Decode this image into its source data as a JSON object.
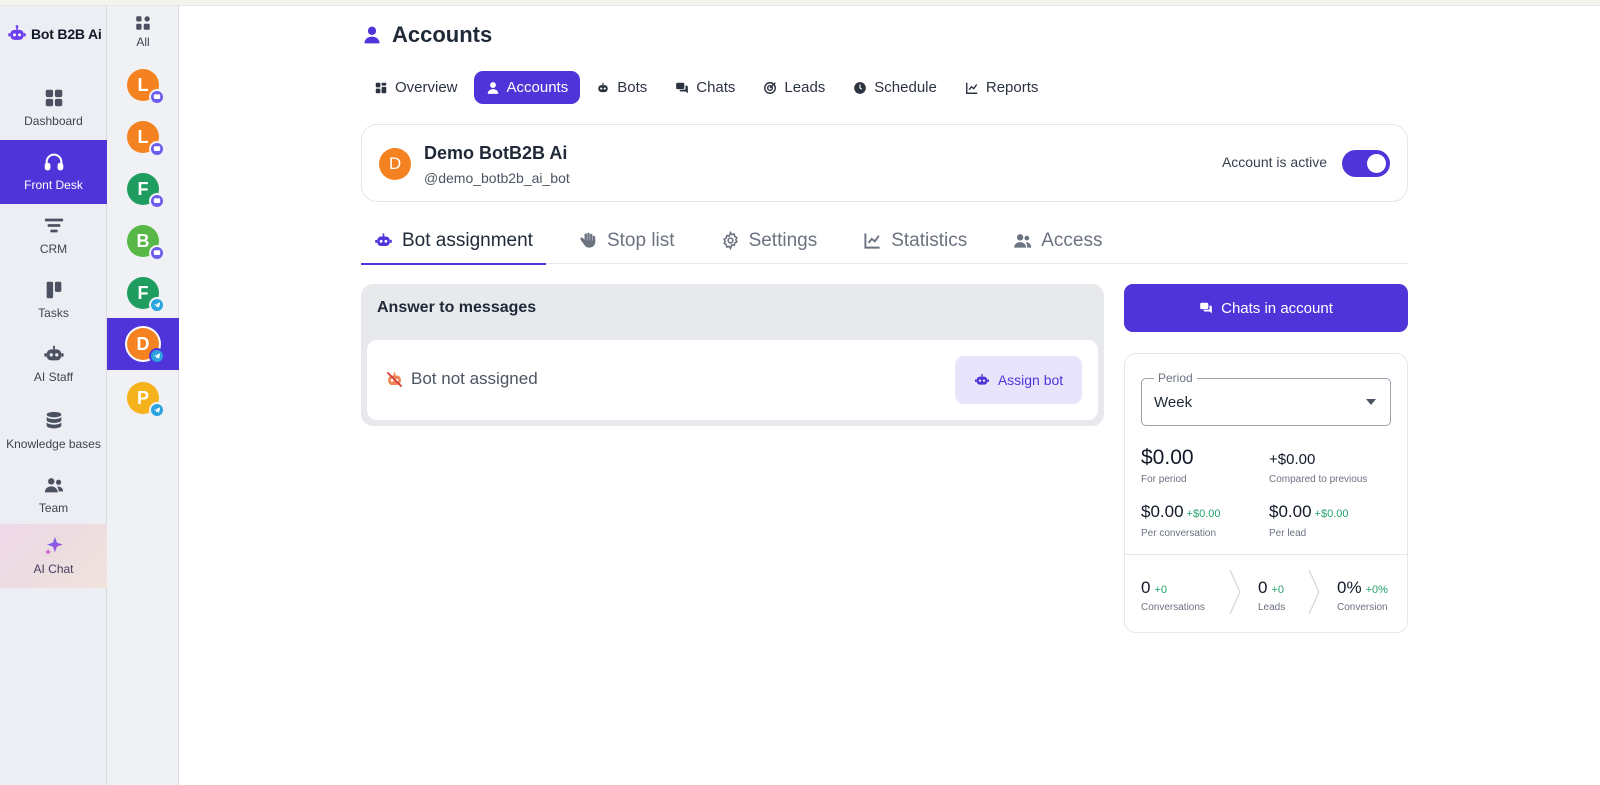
{
  "brand": {
    "name": "Bot B2B Ai",
    "icon": "robot-icon"
  },
  "nav": [
    {
      "label": "Dashboard",
      "icon": "dashboard-icon"
    },
    {
      "label": "Front Desk",
      "icon": "headset-icon",
      "active": true
    },
    {
      "label": "CRM",
      "icon": "funnel-icon"
    },
    {
      "label": "Tasks",
      "icon": "kanban-icon"
    },
    {
      "label": "AI Staff",
      "icon": "robot-icon"
    },
    {
      "label": "Knowledge bases",
      "icon": "database-icon"
    },
    {
      "label": "Team",
      "icon": "team-icon"
    },
    {
      "label": "AI Chat",
      "icon": "sparkle-icon"
    }
  ],
  "accounts_rail": {
    "all_label": "All",
    "items": [
      {
        "initial": "L",
        "color": "#f58220",
        "channel": "chat"
      },
      {
        "initial": "L",
        "color": "#f58220",
        "channel": "chat"
      },
      {
        "initial": "F",
        "color": "#1f9d61",
        "channel": "chat"
      },
      {
        "initial": "B",
        "color": "#58b847",
        "channel": "chat"
      },
      {
        "initial": "F",
        "color": "#1f9d61",
        "channel": "telegram"
      },
      {
        "initial": "D",
        "color": "#f58220",
        "channel": "telegram",
        "active": true
      },
      {
        "initial": "P",
        "color": "#f6b21a",
        "channel": "telegram"
      }
    ]
  },
  "page": {
    "title": "Accounts",
    "tabs": [
      {
        "label": "Overview",
        "icon": "grid-icon"
      },
      {
        "label": "Accounts",
        "icon": "user-icon",
        "active": true
      },
      {
        "label": "Bots",
        "icon": "robot-icon"
      },
      {
        "label": "Chats",
        "icon": "chats-icon"
      },
      {
        "label": "Leads",
        "icon": "target-icon"
      },
      {
        "label": "Schedule",
        "icon": "clock-icon"
      },
      {
        "label": "Reports",
        "icon": "chart-icon"
      }
    ]
  },
  "account": {
    "initial": "D",
    "name": "Demo BotB2B Ai",
    "handle": "@demo_botb2b_ai_bot",
    "status_label": "Account is active",
    "active": true
  },
  "subtabs": [
    {
      "label": "Bot assignment",
      "icon": "robot-icon",
      "active": true
    },
    {
      "label": "Stop list",
      "icon": "hand-icon"
    },
    {
      "label": "Settings",
      "icon": "gear-icon"
    },
    {
      "label": "Statistics",
      "icon": "chart-icon"
    },
    {
      "label": "Access",
      "icon": "users-icon"
    }
  ],
  "answer": {
    "title": "Answer to messages",
    "status": "Bot not assigned",
    "assign_label": "Assign bot"
  },
  "chats_button": "Chats in account",
  "stats": {
    "period_label": "Period",
    "period_value": "Week",
    "for_period": {
      "value": "$0.00",
      "label": "For period"
    },
    "compared": {
      "value": "+$0.00",
      "label": "Compared to previous"
    },
    "per_conversation": {
      "value": "$0.00",
      "delta": "+$0.00",
      "label": "Per conversation"
    },
    "per_lead": {
      "value": "$0.00",
      "delta": "+$0.00",
      "label": "Per lead"
    },
    "funnel": [
      {
        "value": "0",
        "delta": "+0",
        "label": "Conversations"
      },
      {
        "value": "0",
        "delta": "+0",
        "label": "Leads"
      },
      {
        "value": "0%",
        "delta": "+0%",
        "label": "Conversion"
      }
    ]
  }
}
